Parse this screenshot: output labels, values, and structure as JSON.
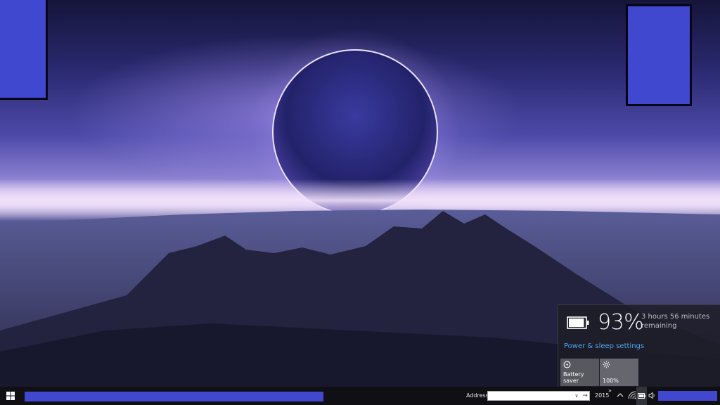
{
  "battery_flyout": {
    "percent": "93%",
    "remaining": "3 hours 56 minutes remaining",
    "power_link": "Power & sleep settings",
    "level": 0.93,
    "tiles": [
      {
        "label": "Battery saver",
        "icon": "battery-saver-icon"
      },
      {
        "label": "100%",
        "icon": "brightness-icon"
      }
    ]
  },
  "taskbar": {
    "start_icon": "windows-logo-icon",
    "address_label": "Address",
    "address_value": "",
    "toolbar_text": "2015",
    "more_chevron": "»",
    "tray_icons": [
      "chevron-up-icon",
      "network-icon",
      "battery-icon",
      "volume-icon"
    ]
  },
  "colors": {
    "overlay": "#4048cf",
    "link": "#4ca6e8",
    "taskbar": "#101014",
    "flyout": "#1e1e28"
  }
}
